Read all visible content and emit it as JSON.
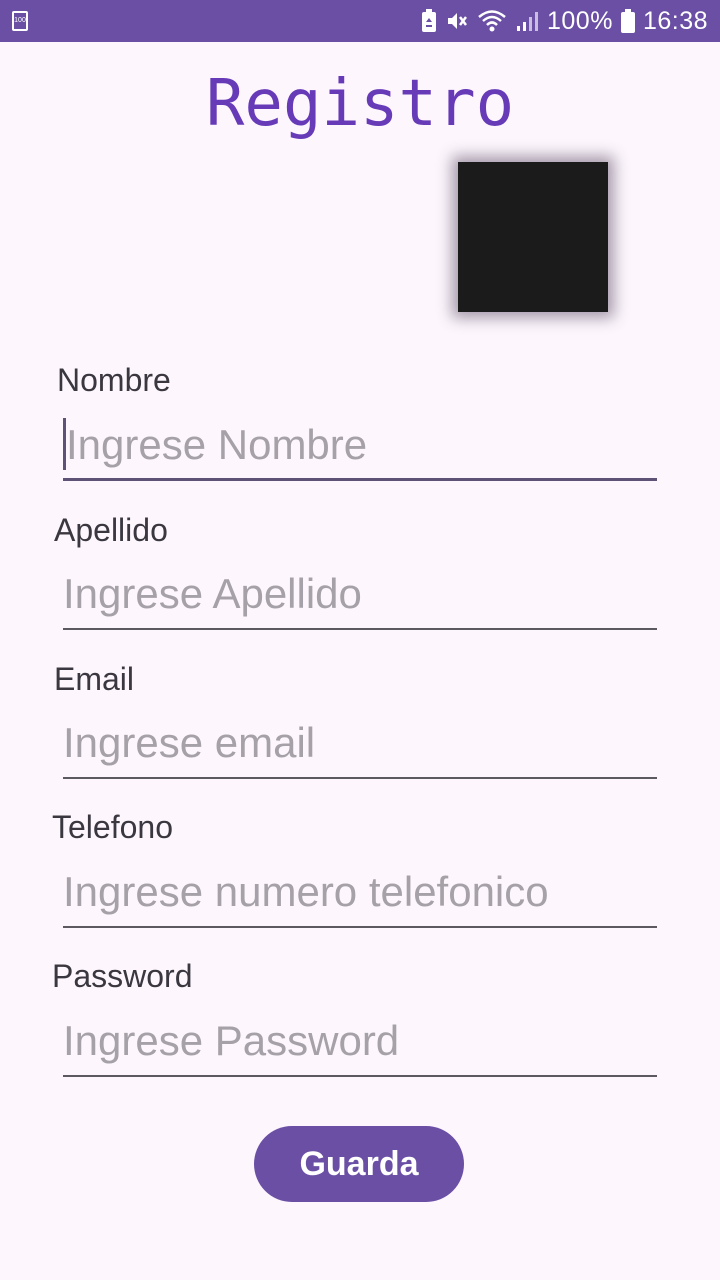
{
  "status_bar": {
    "battery_small_label": "100",
    "battery_percent": "100%",
    "time": "16:38",
    "icons": [
      "battery-saver-icon",
      "mute-icon",
      "wifi-icon",
      "signal-icon",
      "battery-icon"
    ]
  },
  "title": "Registro",
  "fields": [
    {
      "label": "Nombre",
      "placeholder": "Ingrese Nombre",
      "value": "",
      "focused": true
    },
    {
      "label": "Apellido",
      "placeholder": "Ingrese Apellido",
      "value": "",
      "focused": false
    },
    {
      "label": "Email",
      "placeholder": "Ingrese email",
      "value": "",
      "focused": false
    },
    {
      "label": "Telefono",
      "placeholder": "Ingrese numero telefonico",
      "value": "",
      "focused": false
    },
    {
      "label": "Password",
      "placeholder": "Ingrese Password",
      "value": "",
      "focused": false
    }
  ],
  "save_button": "Guarda",
  "colors": {
    "accent": "#673ab7",
    "status_bar": "#6a4fa5",
    "background": "#fdf7fd",
    "placeholder": "#a6a1a8",
    "label": "#3a3740"
  }
}
